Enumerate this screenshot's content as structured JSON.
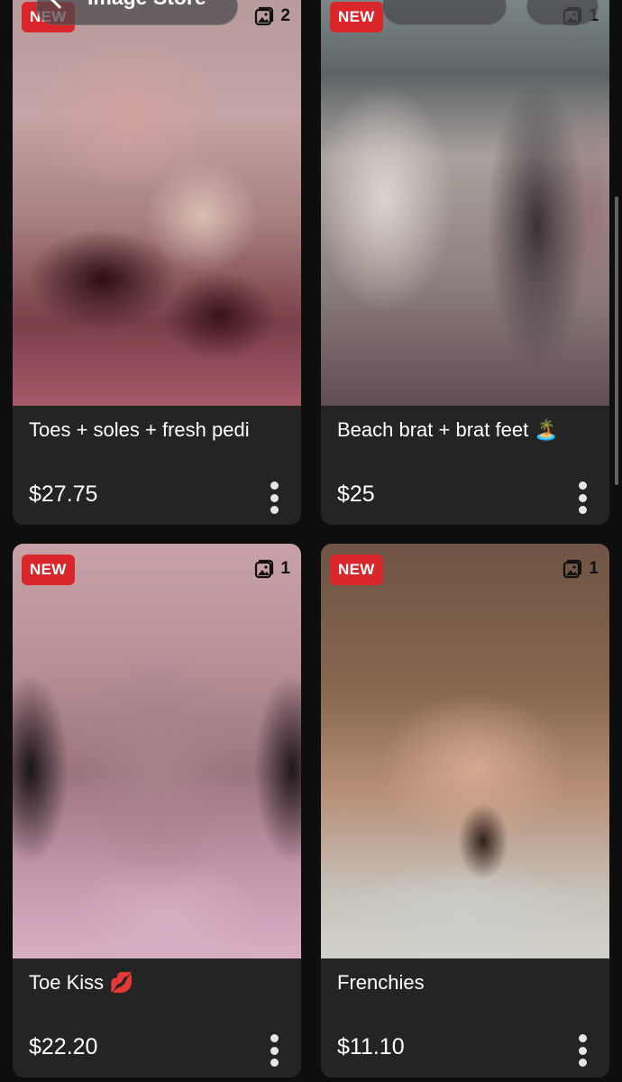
{
  "header": {
    "title": "Image Store",
    "back_icon": "chevron-left-icon"
  },
  "products": [
    {
      "badge": "NEW",
      "image_count": "2",
      "name": "Toes + soles + fresh pedi",
      "price": "$27.75"
    },
    {
      "badge": "NEW",
      "image_count": "1",
      "name": "Beach brat + brat feet 🏝️",
      "price": "$25"
    },
    {
      "badge": "NEW",
      "image_count": "1",
      "name": "Toe Kiss 💋",
      "price": "$22.20"
    },
    {
      "badge": "NEW",
      "image_count": "1",
      "name": "Frenchies",
      "price": "$11.10"
    }
  ],
  "icons": {
    "gallery": "gallery-icon",
    "more": "more-vertical-icon"
  },
  "colors": {
    "badge": "#d9262a",
    "card": "#242424",
    "background": "#0e0e0e"
  }
}
